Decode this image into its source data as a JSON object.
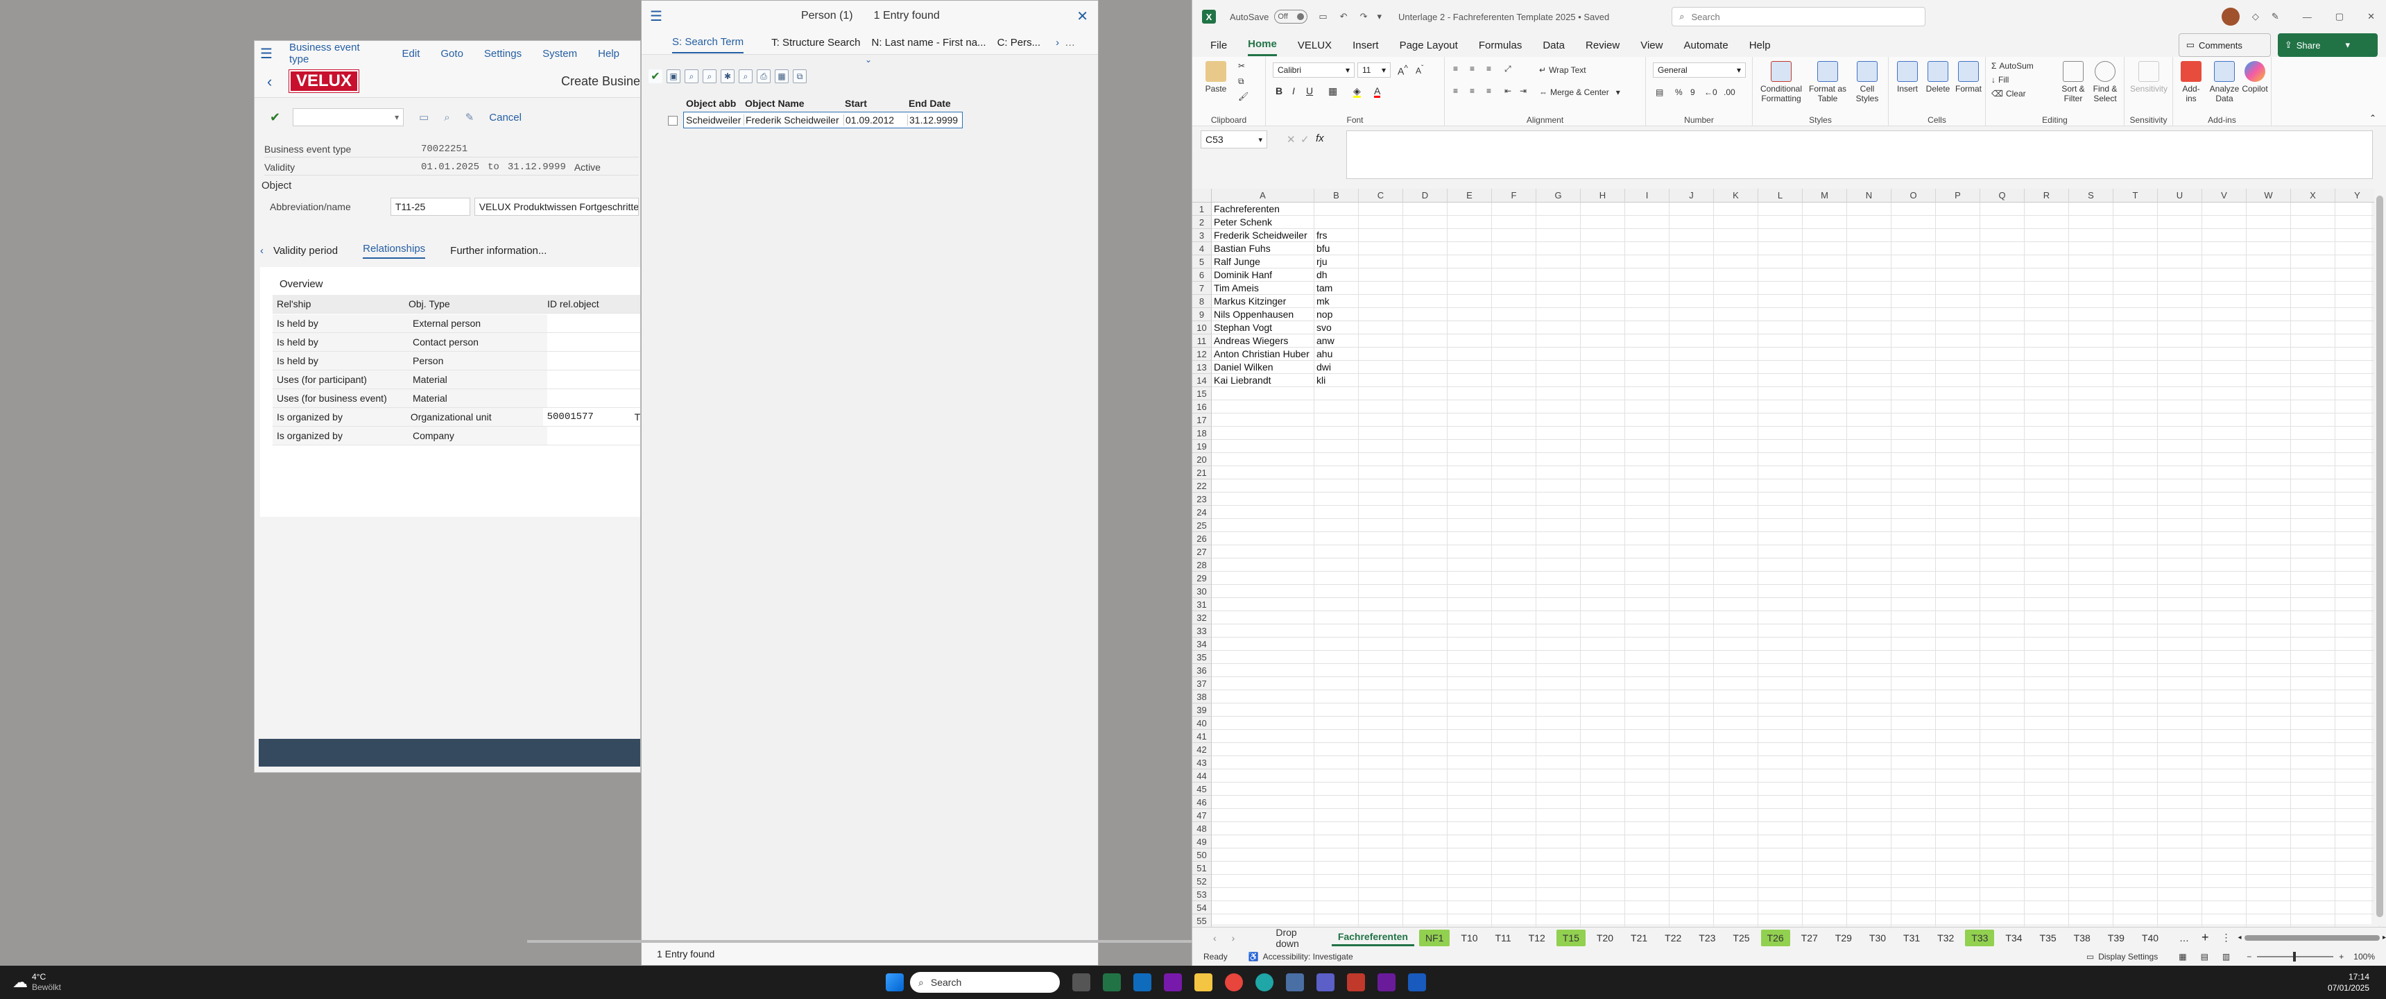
{
  "sap": {
    "menu": [
      "Business event type",
      "Edit",
      "Goto",
      "Settings",
      "System",
      "Help"
    ],
    "logo": "VELUX",
    "title": "Create Business",
    "cancel": "Cancel",
    "fields": {
      "bet_label": "Business event type",
      "bet_value": "70022251",
      "validity_label": "Validity",
      "valid_from": "01.01.2025",
      "to": "to",
      "valid_to": "31.12.9999",
      "status": "Active",
      "object_label": "Object",
      "abbr_label": "Abbreviation/name",
      "abbr_value": "T11-25",
      "name_value": "VELUX Produktwissen Fortgeschritten"
    },
    "tabs": [
      "Validity period",
      "Relationships",
      "Further information..."
    ],
    "overview": "Overview",
    "rel_headers": [
      "Rel'ship",
      "Obj. Type",
      "ID rel.object"
    ],
    "rels": [
      {
        "rel": "Is held by",
        "type": "External person",
        "id": ""
      },
      {
        "rel": "Is held by",
        "type": "Contact person",
        "id": ""
      },
      {
        "rel": "Is held by",
        "type": "Person",
        "id": ""
      },
      {
        "rel": "Uses (for participant)",
        "type": "Material",
        "id": ""
      },
      {
        "rel": "Uses (for business event)",
        "type": "Material",
        "id": ""
      },
      {
        "rel": "Is organized by",
        "type": "Organizational unit",
        "id": "50001577",
        "extra": "T"
      },
      {
        "rel": "Is organized by",
        "type": "Company",
        "id": ""
      }
    ]
  },
  "person": {
    "title": "Person (1)",
    "count": "1 Entry found",
    "tabs": [
      "S: Search Term",
      "T: Structure Search",
      "N: Last name - First na...",
      "C: Pers..."
    ],
    "headers": [
      "Object abb",
      "Object Name",
      "Start",
      "End Date"
    ],
    "row": {
      "abbr": "Scheidweiler",
      "name": "Frederik Scheidweiler",
      "start": "01.09.2012",
      "end": "31.12.9999"
    },
    "status": "1 Entry found"
  },
  "excel": {
    "autosave": "AutoSave",
    "autosave_state": "Off",
    "file_title": "Unterlage 2 - Fachreferenten Template 2025 • Saved",
    "search": "Search",
    "tabs": [
      "File",
      "Home",
      "VELUX",
      "Insert",
      "Page Layout",
      "Formulas",
      "Data",
      "Review",
      "View",
      "Automate",
      "Help"
    ],
    "comments": "Comments",
    "share": "Share",
    "ribbon": {
      "paste": "Paste",
      "clipboard": "Clipboard",
      "font_name": "Calibri",
      "font_size": "11",
      "font": "Font",
      "wrap": "Wrap Text",
      "merge": "Merge & Center",
      "alignment": "Alignment",
      "numfmt": "General",
      "number": "Number",
      "cond": "Conditional Formatting",
      "fmt_table": "Format as Table",
      "cell_styles": "Cell Styles",
      "styles": "Styles",
      "insert": "Insert",
      "delete": "Delete",
      "format": "Format",
      "cells": "Cells",
      "autosum": "AutoSum",
      "fill": "Fill",
      "clear": "Clear",
      "sort": "Sort & Filter",
      "find": "Find & Select",
      "editing": "Editing",
      "sensitivity": "Sensitivity",
      "addins": "Add-ins",
      "analyze": "Analyze Data",
      "copilot": "Copilot"
    },
    "namebox": "C53",
    "fx": "fx",
    "columns": [
      "A",
      "B",
      "C",
      "D",
      "E",
      "F",
      "G",
      "H",
      "I",
      "J",
      "K",
      "L",
      "M",
      "N",
      "O",
      "P",
      "Q",
      "R",
      "S",
      "T",
      "U",
      "V",
      "W",
      "X",
      "Y"
    ],
    "rows": [
      [
        "Fachreferenten",
        ""
      ],
      [
        "Peter Schenk",
        ""
      ],
      [
        "Frederik Scheidweiler",
        "frs"
      ],
      [
        "Bastian Fuhs",
        "bfu"
      ],
      [
        "Ralf Junge",
        "rju"
      ],
      [
        "Dominik Hanf",
        "dh"
      ],
      [
        "Tim Ameis",
        "tam"
      ],
      [
        "Markus Kitzinger",
        "mk"
      ],
      [
        "Nils Oppenhausen",
        "nop"
      ],
      [
        "Stephan Vogt",
        "svo"
      ],
      [
        "Andreas Wiegers",
        "anw"
      ],
      [
        "Anton Christian Huber",
        "ahu"
      ],
      [
        "Daniel Wilken",
        "dwi"
      ],
      [
        "Kai Liebrandt",
        "kli"
      ]
    ],
    "row_count": 55,
    "sheets": [
      {
        "name": "Drop down",
        "style": "plain"
      },
      {
        "name": "Fachreferenten",
        "style": "active"
      },
      {
        "name": "NF1",
        "style": "green"
      },
      {
        "name": "T10",
        "style": "plain"
      },
      {
        "name": "T11",
        "style": "plain"
      },
      {
        "name": "T12",
        "style": "plain"
      },
      {
        "name": "T15",
        "style": "green"
      },
      {
        "name": "T20",
        "style": "plain"
      },
      {
        "name": "T21",
        "style": "plain"
      },
      {
        "name": "T22",
        "style": "plain"
      },
      {
        "name": "T23",
        "style": "plain"
      },
      {
        "name": "T25",
        "style": "plain"
      },
      {
        "name": "T26",
        "style": "green"
      },
      {
        "name": "T27",
        "style": "plain"
      },
      {
        "name": "T29",
        "style": "plain"
      },
      {
        "name": "T30",
        "style": "plain"
      },
      {
        "name": "T31",
        "style": "plain"
      },
      {
        "name": "T32",
        "style": "plain"
      },
      {
        "name": "T33",
        "style": "green"
      },
      {
        "name": "T34",
        "style": "plain"
      },
      {
        "name": "T35",
        "style": "plain"
      },
      {
        "name": "T38",
        "style": "plain"
      },
      {
        "name": "T39",
        "style": "plain"
      },
      {
        "name": "T40",
        "style": "plain"
      }
    ],
    "status_ready": "Ready",
    "accessibility": "Accessibility: Investigate",
    "display_settings": "Display Settings",
    "zoom": "100%"
  },
  "taskbar": {
    "weather_temp": "4°C",
    "weather_desc": "Bewölkt",
    "search": "Search",
    "time": "17:14",
    "date": "07/01/2025"
  },
  "colors": {
    "excel_green": "#217346",
    "sap_link": "#245ea3",
    "velux_red": "#c8102e",
    "sheet_green": "#92d050"
  }
}
